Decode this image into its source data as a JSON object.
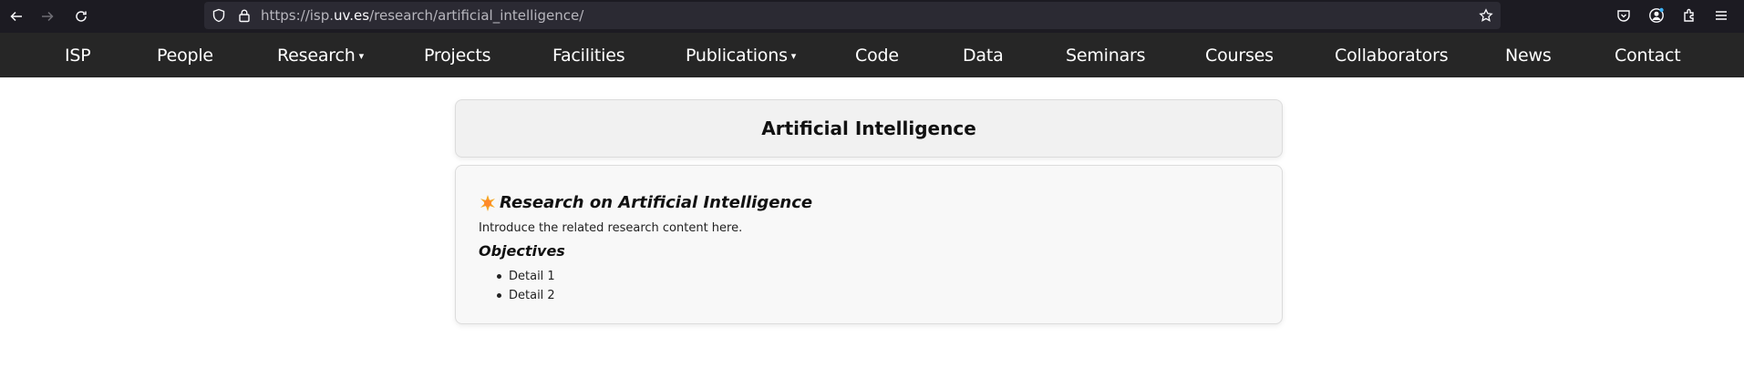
{
  "browser": {
    "url_prefix": "https://isp.",
    "url_host": "uv.es",
    "url_path": "/research/artificial_intelligence/",
    "icons": [
      "back-arrow-icon",
      "forward-arrow-icon",
      "reload-icon",
      "shield-icon",
      "lock-icon",
      "star-icon",
      "pocket-icon",
      "account-icon",
      "extensions-icon",
      "menu-icon"
    ]
  },
  "nav": {
    "items": [
      {
        "label": "ISP"
      },
      {
        "label": "People"
      },
      {
        "label": "Research",
        "dropdown": true
      },
      {
        "label": "Projects"
      },
      {
        "label": "Facilities"
      },
      {
        "label": "Publications",
        "dropdown": true
      },
      {
        "label": "Code"
      },
      {
        "label": "Data"
      },
      {
        "label": "Seminars"
      },
      {
        "label": "Courses"
      },
      {
        "label": "Collaborators"
      },
      {
        "label": "News"
      },
      {
        "label": "Contact"
      }
    ],
    "caret": "▾"
  },
  "page": {
    "title": "Artificial Intelligence",
    "section_title": "Research on Artificial Intelligence",
    "intro": "Introduce the related research content here.",
    "objectives_title": "Objectives",
    "details": [
      "Detail 1",
      "Detail 2"
    ]
  },
  "colors": {
    "nav_bg": "#262626",
    "browser_bg": "#1c1b22",
    "urlbar_bg": "#2b2a33",
    "card_bg": "#f8f8f8",
    "title_bg": "#f1f1f1"
  }
}
